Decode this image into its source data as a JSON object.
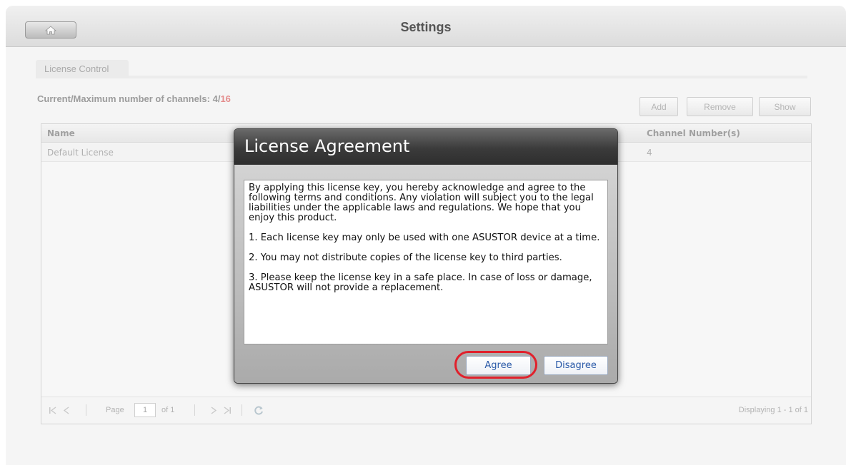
{
  "window": {
    "title": "Settings"
  },
  "tabs": [
    {
      "label": "License Control"
    }
  ],
  "channels": {
    "label": "Current/Maximum number of channels: 4/",
    "maximum": "16"
  },
  "toolbar": {
    "add_label": "Add",
    "remove_label": "Remove",
    "show_label": "Show"
  },
  "grid": {
    "columns": [
      "Name",
      "Channel Number(s)"
    ],
    "rows": [
      {
        "name": "Default License",
        "channels": "4"
      }
    ]
  },
  "pager": {
    "page_label": "Page",
    "page_value": "1",
    "of_label": "of 1",
    "displaying": "Displaying 1 - 1 of 1"
  },
  "dialog": {
    "title": "License Agreement",
    "paragraphs": [
      "By applying this license key, you hereby acknowledge and agree to the following terms and conditions. Any violation will subject you to the legal liabilities under the applicable laws and regulations. We hope that you enjoy this product.",
      "1. Each license key may only be used with one ASUSTOR device at a time.",
      "2. You may not distribute copies of the license key to third parties.",
      "3. Please keep the license key in a safe place. In case of loss or damage, ASUSTOR will not provide a replacement."
    ],
    "agree_label": "Agree",
    "disagree_label": "Disagree"
  },
  "colors": {
    "highlight_ring": "#e0212c",
    "max_channels": "#e48c8c",
    "button_text": "#2a5aa8"
  },
  "icons": [
    "home-icon",
    "first-page-icon",
    "prev-page-icon",
    "next-page-icon",
    "last-page-icon",
    "refresh-icon"
  ]
}
